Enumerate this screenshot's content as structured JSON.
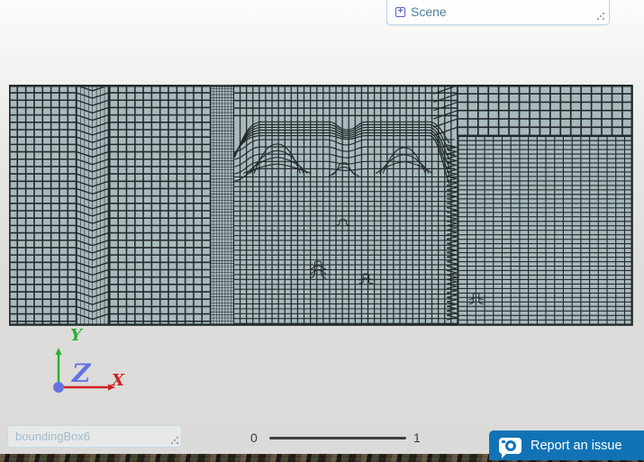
{
  "colors": {
    "accent_blue": "#1173b6",
    "mesh_fill": "#a9babd",
    "mesh_line": "#232a2c",
    "panel_border": "#b9d7e6",
    "scene_text": "#4e7f9e",
    "slider_track": "#3f3f3f"
  },
  "scene_panel": {
    "label": "Scene",
    "expand_glyph": "+"
  },
  "axis_triad": {
    "x_label": "X",
    "y_label": "Y",
    "z_label": "Z",
    "x_color": "#cf2121",
    "y_color": "#2fae2f",
    "z_color": "#6572e4",
    "origin_color": "#6673de"
  },
  "controls": {
    "name_input_placeholder": "boundingBox6",
    "slider_min": "0",
    "slider_max": "1",
    "report_button_label": "Report an issue"
  }
}
